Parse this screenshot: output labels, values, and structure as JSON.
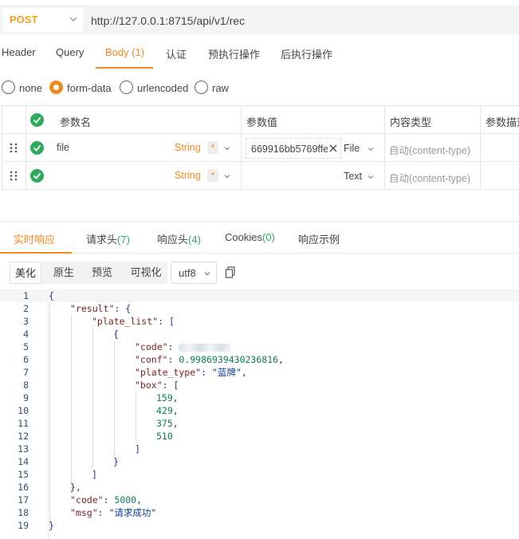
{
  "request": {
    "method": "POST",
    "url": "http://127.0.0.1:8715/api/v1/rec"
  },
  "request_tabs": [
    "Header",
    "Query",
    "Body",
    "(1)",
    "认证",
    "预执行操作",
    "后执行操作"
  ],
  "body_modes": [
    "none",
    "form-data",
    "urlencoded",
    "raw"
  ],
  "body_selected": "form-data",
  "params": {
    "headers": [
      "参数名",
      "参数值",
      "内容类型",
      "参数描述"
    ],
    "rows": [
      {
        "name": "file",
        "type": "String",
        "required": "*",
        "value": "669916bb5769ffe",
        "value_kind": "File",
        "content_type": "自动(content-type)"
      },
      {
        "name": "",
        "type": "String",
        "required": "*",
        "value": "",
        "value_kind": "Text",
        "content_type": "自动(content-type)"
      }
    ]
  },
  "response_tabs": {
    "live": "实时响应",
    "req_headers": "请求头",
    "req_headers_count": "(7)",
    "resp_headers": "响应头",
    "resp_headers_count": "(4)",
    "cookies": "Cookies",
    "cookies_count": "(0)",
    "example": "响应示例"
  },
  "view_modes": [
    "美化",
    "原生",
    "预览",
    "可视化"
  ],
  "view_selected": "美化",
  "encoding": "utf8",
  "response_json": {
    "line_numbers": [
      "1",
      "2",
      "3",
      "4",
      "5",
      "6",
      "7",
      "8",
      "9",
      "10",
      "11",
      "12",
      "13",
      "14",
      "15",
      "16",
      "17",
      "18",
      "19"
    ],
    "tokens": {
      "open": "{",
      "result_key": "\"result\"",
      "colon_brace": ": {",
      "plate_list_key": "\"plate_list\"",
      "colon_bracket": ": [",
      "obj_open": "{",
      "code_key": "\"code\"",
      "colon": ": ",
      "conf_key": "\"conf\"",
      "conf_val": "0.9986939430236816",
      "comma": ",",
      "plate_type_key": "\"plate_type\"",
      "plate_type_val": "\"蓝牌\"",
      "box_key": "\"box\"",
      "box": [
        "159",
        "429",
        "375",
        "510"
      ],
      "close_bracket": "]",
      "close_brace": "}",
      "close_brace_comma": "},",
      "code_top_key": "\"code\"",
      "code_top_val": "5000",
      "msg_key": "\"msg\"",
      "msg_val": "\"请求成功\""
    }
  },
  "colors": {
    "accent": "#f08a1c",
    "success": "#2eaa5c",
    "method": "#f0a020"
  }
}
